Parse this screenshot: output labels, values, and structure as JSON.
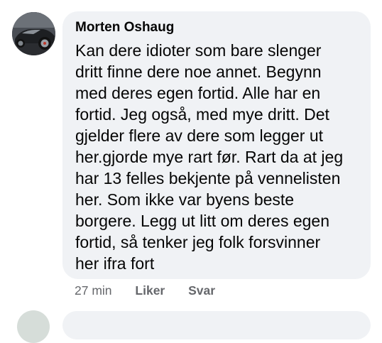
{
  "comment": {
    "author": "Morten Oshaug",
    "lines": [
      "Kan dere idioter som bare slenger",
      "dritt finne dere noe annet. Begynn",
      "med deres egen fortid. Alle har en",
      "fortid. Jeg også, med mye dritt. Det",
      "gjelder flere av dere som legger ut",
      "her.gjorde mye rart før. Rart da at jeg",
      "har 13 felles bekjente på vennelisten",
      "her. Som ikke var byens beste",
      "borgere. Legg ut litt om deres egen",
      "fortid, så tenker jeg folk forsvinner",
      "her ifra fort"
    ],
    "time": "27 min",
    "like_label": "Liker",
    "reply_label": "Svar"
  },
  "colors": {
    "bubble": "#f0f2f5",
    "text": "#050505",
    "meta": "#65676b"
  }
}
